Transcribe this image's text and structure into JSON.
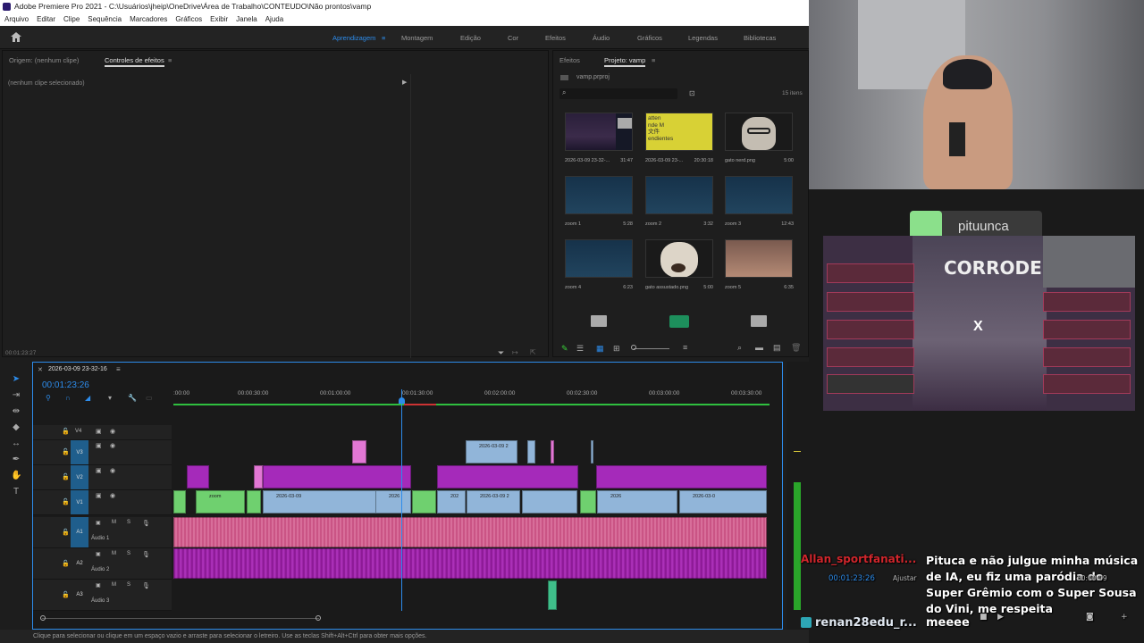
{
  "window": {
    "title": "Adobe Premiere Pro 2021 - C:\\Usuários\\jheip\\OneDrive\\Área de Trabalho\\CONTEUDO\\Não prontos\\vamp"
  },
  "menu": [
    "Arquivo",
    "Editar",
    "Clipe",
    "Sequência",
    "Marcadores",
    "Gráficos",
    "Exibir",
    "Janela",
    "Ajuda"
  ],
  "workspaces": [
    "Aprendizagem",
    "Montagem",
    "Edição",
    "Cor",
    "Efeitos",
    "Áudio",
    "Gráficos",
    "Legendas",
    "Bibliotecas"
  ],
  "source": {
    "tab_origin": "Origem: (nenhum clipe)",
    "tab_effects": "Controles de efeitos",
    "no_clip": "(nenhum clipe selecionado)",
    "timecode": "00:01:23:27"
  },
  "project": {
    "tab_effects": "Efeitos",
    "tab_project": "Projeto: vamp",
    "file": "vamp.prproj",
    "count": "15 itens",
    "items": [
      {
        "name": "2026-03-09 23-32-...",
        "dur": "31:47"
      },
      {
        "name": "2026-03-09 23-...",
        "dur": "20:30:18"
      },
      {
        "name": "gato nerd.png",
        "dur": "5:00"
      },
      {
        "name": "zoom 1",
        "dur": "5:28"
      },
      {
        "name": "zoom 2",
        "dur": "3:32"
      },
      {
        "name": "zoom 3",
        "dur": "12:43"
      },
      {
        "name": "zoom 4",
        "dur": "6:23"
      },
      {
        "name": "gato assustado.png",
        "dur": "5:00"
      },
      {
        "name": "zoom 5",
        "dur": "6:35"
      }
    ],
    "thumb2_text": "atten\nnde M\n文件\nendientes"
  },
  "timeline": {
    "seq_name": "2026-03-09 23-32-16",
    "timecode": "00:01:23:26",
    "ruler": [
      ":00:00",
      "00:00:30:00",
      "00:01:00:00",
      "00:01:30:00",
      "00:02:00:00",
      "00:02:30:00",
      "00:03:00:00",
      "00:03:30:00"
    ],
    "tracks": {
      "v4": "V4",
      "v3": "V3",
      "v2": "V2",
      "v1": "V1",
      "a1": "A1",
      "a2": "A2",
      "a3": "A3"
    },
    "audio_names": [
      "Áudio 1",
      "Áudio 2",
      "Áudio 3"
    ],
    "clip_labels": {
      "v3_clip": "2026-03-09 2",
      "v1_zoom": "zoom",
      "v1_a": "2026-03-09",
      "v1_b": "2026",
      "v1_c": "202",
      "v1_d": "2026-03-09 2",
      "v1_e": "2026",
      "v1_f": "2026-03-0"
    }
  },
  "status": "Clique para selecionar ou clique em um espaço vazio e arraste para selecionar o letreiro. Use as teclas Shift+Alt+Ctrl para obter mais opções.",
  "overlay": {
    "streamer": "pituunca",
    "game_title": "CORRODE",
    "vs": "X",
    "chat": [
      {
        "user": "Allan_sportfanati...",
        "msg": "Pituca e não julgue minha música de IA, eu fiz uma paródia do Super Grêmio com o Super Sousa do Vini, me respeita"
      },
      {
        "user": "renan28edu_r...",
        "msg": "meeee"
      }
    ],
    "prog_timecode": "00:01:23:26",
    "prog_fit": "Ajustar",
    "prog_tc2": "00:00:09"
  },
  "colors": {
    "accent": "#2d8ceb",
    "v_clip": "#91b5d9",
    "green_clip": "#6fd06f",
    "purple_clip": "#a52aba",
    "audio1": "#c2487a",
    "audio2": "#85148e"
  }
}
